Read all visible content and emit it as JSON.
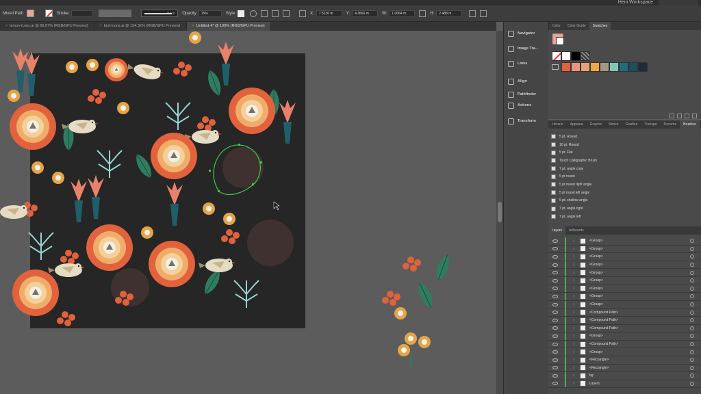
{
  "topbar": {
    "workspace": "Heni Workspace"
  },
  "control_bar": {
    "fill_label": "Mixed Path",
    "stroke_label": "Stroke",
    "brush_label": "Basic",
    "opacity_label": "Opacity",
    "opacity_value": "15%",
    "style_label": "Style",
    "x_label": "X:",
    "x_value": "7.5236 m",
    "y_label": "Y:",
    "y_value": "4.3666 m",
    "w_label": "W:",
    "w_value": "1.0664 m",
    "h_label": "H:",
    "h_value": "2.488 m"
  },
  "tabs": [
    {
      "label": "lemon-icons.ai @ 66.67% (RGB/GPU Preview)",
      "active": false
    },
    {
      "label": "bird-icons.ai @ 154.32% (RGB/GPU Preview)",
      "active": false
    },
    {
      "label": "Untitled-4* @ 100% (RGB/GPU Preview)",
      "active": true
    }
  ],
  "dock": [
    {
      "label": "Navigator",
      "icon": "navigator-icon"
    },
    {
      "label": "Image Tra...",
      "icon": "image-trace-icon"
    },
    {
      "label": "Links",
      "icon": "links-icon"
    },
    {
      "label": "Align",
      "icon": "align-icon"
    },
    {
      "label": "Pathfinder",
      "icon": "pathfinder-icon"
    },
    {
      "label": "Actions",
      "icon": "actions-icon"
    },
    {
      "label": "Transform",
      "icon": "transform-icon"
    }
  ],
  "swatch_panel": {
    "tabs": [
      {
        "label": "Color",
        "active": false
      },
      {
        "label": "Color Guide",
        "active": false
      },
      {
        "label": "Swatches",
        "active": true
      }
    ],
    "row1": [
      "#ffffff",
      "#ffffff",
      "#000000",
      "#888888"
    ],
    "row2": [
      "#e0623c",
      "#e8967a",
      "#e2a27a",
      "#f0a545",
      "#a39a7e",
      "#7fc7b4",
      "#1f6d77",
      "#1b4f5c",
      "#1e2c38"
    ]
  },
  "brush_panel": {
    "tabs": [
      {
        "label": "Librarie",
        "active": false
      },
      {
        "label": "Appeara",
        "active": false
      },
      {
        "label": "Graphic",
        "active": false
      },
      {
        "label": "Stroke",
        "active": false
      },
      {
        "label": "Gradien",
        "active": false
      },
      {
        "label": "Transpa",
        "active": false
      },
      {
        "label": "Docume",
        "active": false
      },
      {
        "label": "Brushes",
        "active": true
      }
    ],
    "items": [
      "5 pt. Round",
      "10 pt. Round",
      "5 pt. Flat",
      "Touch Calligraphic Brush",
      "7 pt. angle copy",
      "5 pt round",
      "5 pt round right angle",
      "5 pt round left angle",
      "5 pt. shallow angle",
      "7 pt. angle right",
      "7 pt. angle left"
    ]
  },
  "layers_panel": {
    "tabs": [
      {
        "label": "Layers",
        "active": true
      },
      {
        "label": "Artboards",
        "active": false
      }
    ],
    "rows": [
      "<Group>",
      "<Group>",
      "<Group>",
      "<Group>",
      "<Group>",
      "<Group>",
      "<Group>",
      "<Group>",
      "<Group>",
      "<Compound Path>",
      "<Compound Path>",
      "<Compound Path>",
      "<Group>",
      "<Compound Path>",
      "<Group>",
      "<Rectangle>",
      "<Rectangle>",
      "bg",
      "Layer1"
    ]
  }
}
